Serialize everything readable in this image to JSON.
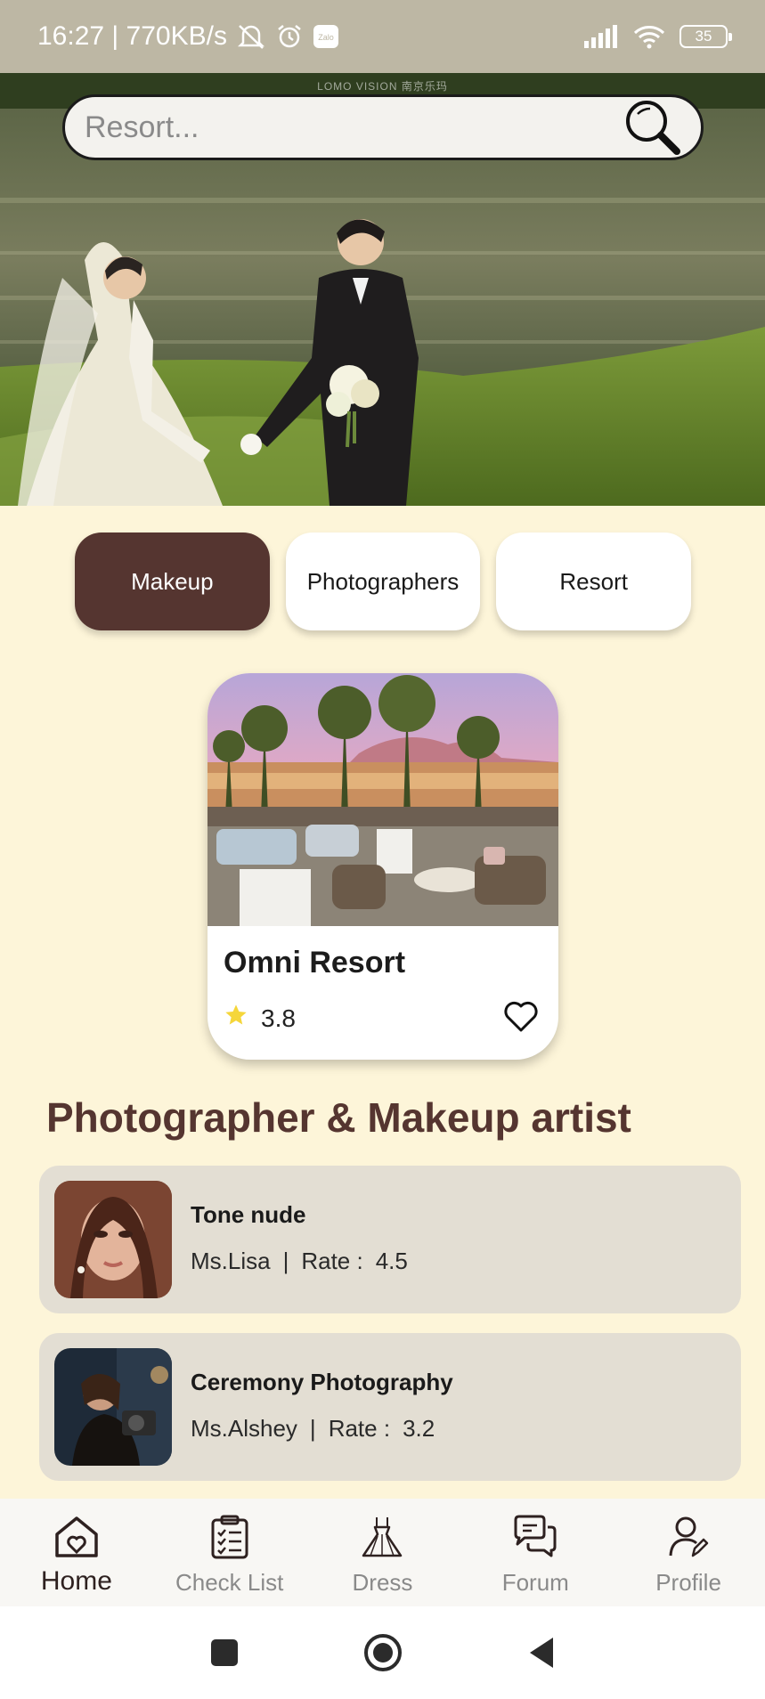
{
  "status_bar": {
    "time_speed": "16:27 | 770KB/s",
    "battery": "35",
    "zalo_label": "Zalo"
  },
  "hero": {
    "watermark": "LOMO VISION 南京乐玛",
    "search_placeholder": "Resort..."
  },
  "tabs": [
    {
      "label": "Makeup",
      "active": true
    },
    {
      "label": "Photographers",
      "active": false
    },
    {
      "label": "Resort",
      "active": false
    }
  ],
  "featured": {
    "title": "Omni Resort",
    "rating": "3.8"
  },
  "section": {
    "title": "Photographer & Makeup artist"
  },
  "artists": [
    {
      "service": "Tone nude",
      "name": "Ms.Lisa",
      "separator": "|",
      "rate_label": "Rate :",
      "rate": "4.5"
    },
    {
      "service": "Ceremony Photography",
      "name": "Ms.Alshey",
      "separator": "|",
      "rate_label": "Rate :",
      "rate": "3.2"
    }
  ],
  "nav": {
    "home": "Home",
    "checklist": "Check List",
    "dress": "Dress",
    "forum": "Forum",
    "profile": "Profile"
  },
  "colors": {
    "background": "#fdf5d9",
    "accent": "#553530",
    "card_bg": "#e3ded3",
    "status_bar": "#bdb7a4",
    "star": "#f5d63a"
  },
  "icons": [
    "search-icon",
    "star-icon",
    "heart-icon",
    "home-icon",
    "checklist-icon",
    "dress-icon",
    "forum-icon",
    "profile-icon"
  ]
}
